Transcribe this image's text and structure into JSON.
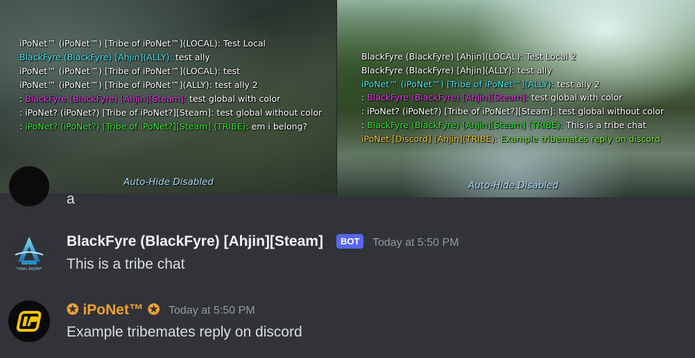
{
  "screenshots": {
    "left": {
      "lines": [
        [
          {
            "text": "iPoNet™ (iPoNet™) [Tribe of iPoNet™](LOCAL): Test Local",
            "color": "white"
          }
        ],
        [
          {
            "text": "BlackFyre (BlackFyre) [Ahjin](ALLY): ",
            "color": "cyan"
          },
          {
            "text": "test ally",
            "color": "white"
          }
        ],
        [
          {
            "text": "iPoNet™ (iPoNet™) [Tribe of iPoNet™](LOCAL): test",
            "color": "white"
          }
        ],
        [
          {
            "text": "iPoNet™ (iPoNet™) [Tribe of iPoNet™](ALLY): test ally 2",
            "color": "white"
          }
        ],
        [
          {
            "text": ": ",
            "color": "white"
          },
          {
            "text": "BlackFyre (BlackFyre) [Ahjin][Steam]: ",
            "color": "magenta"
          },
          {
            "text": "test global with color",
            "color": "white"
          }
        ],
        [
          {
            "text": ": iPoNet? (iPoNet?) [Tribe of iPoNet?][Steam]: test global without color",
            "color": "white"
          }
        ],
        [
          {
            "text": ": ",
            "color": "white"
          },
          {
            "text": "iPoNet? (iPoNet?) [Tribe of iPoNet?][Steam] (TRIBE): ",
            "color": "green"
          },
          {
            "text": "em i belong?",
            "color": "white"
          }
        ]
      ],
      "status": "Auto-Hide Disabled"
    },
    "right": {
      "lines": [
        [
          {
            "text": "BlackFyre (BlackFyre) [Ahjin](LOCAL): Test Local 2",
            "color": "white"
          }
        ],
        [
          {
            "text": "BlackFyre (BlackFyre) [Ahjin](ALLY): test ally",
            "color": "white"
          }
        ],
        [
          {
            "text": "iPoNet™ (iPoNet™) [Tribe of iPoNet™](ALLY): ",
            "color": "cyan"
          },
          {
            "text": "test ally 2",
            "color": "white"
          }
        ],
        [
          {
            "text": ": ",
            "color": "white"
          },
          {
            "text": "BlackFyre (BlackFyre) [Ahjin][Steam]: ",
            "color": "magenta"
          },
          {
            "text": "test global with color",
            "color": "white"
          }
        ],
        [
          {
            "text": ": iPoNet? (iPoNet?) [Tribe of iPoNet?][Steam]: test global without color",
            "color": "white"
          }
        ],
        [
          {
            "text": ": ",
            "color": "white"
          },
          {
            "text": "BlackFyre (BlackFyre) [Ahjin][Steam] (TRIBE): ",
            "color": "green"
          },
          {
            "text": "This is a tribe chat",
            "color": "white"
          }
        ],
        [
          {
            "text": "iPoNet [Discord] [Ahjin](TRIBE): ",
            "color": "yellow"
          },
          {
            "text": "Example tribemates reply on discord",
            "color": "lime"
          }
        ]
      ],
      "status": "Auto-Hide Disabled"
    }
  },
  "partial_message": {
    "text": "a"
  },
  "messages": [
    {
      "author": "BlackFyre (BlackFyre) [Ahjin][Steam]",
      "badge": "BOT",
      "timestamp": "Today at 5:50 PM",
      "content": "This is a tribe chat",
      "avatar_icon": "ark-survival-ascended-logo",
      "avatar_caption": "SURVIVAL ASCENDED"
    },
    {
      "author_star_left": "✪",
      "author": "iPoNet™",
      "author_star_right": "✪",
      "timestamp": "Today at 5:50 PM",
      "content": "Example tribemates reply on discord",
      "avatar_icon": "iponet-logo"
    }
  ],
  "colors": {
    "white": "#ffffff",
    "cyan": "#4de8f0",
    "magenta": "#e83ce8",
    "green": "#3be83b",
    "yellow": "#f0c83c",
    "lime": "#7cf03c",
    "author_orange": "#f0a134",
    "bot_badge": "#5865f2",
    "background": "#313338"
  }
}
